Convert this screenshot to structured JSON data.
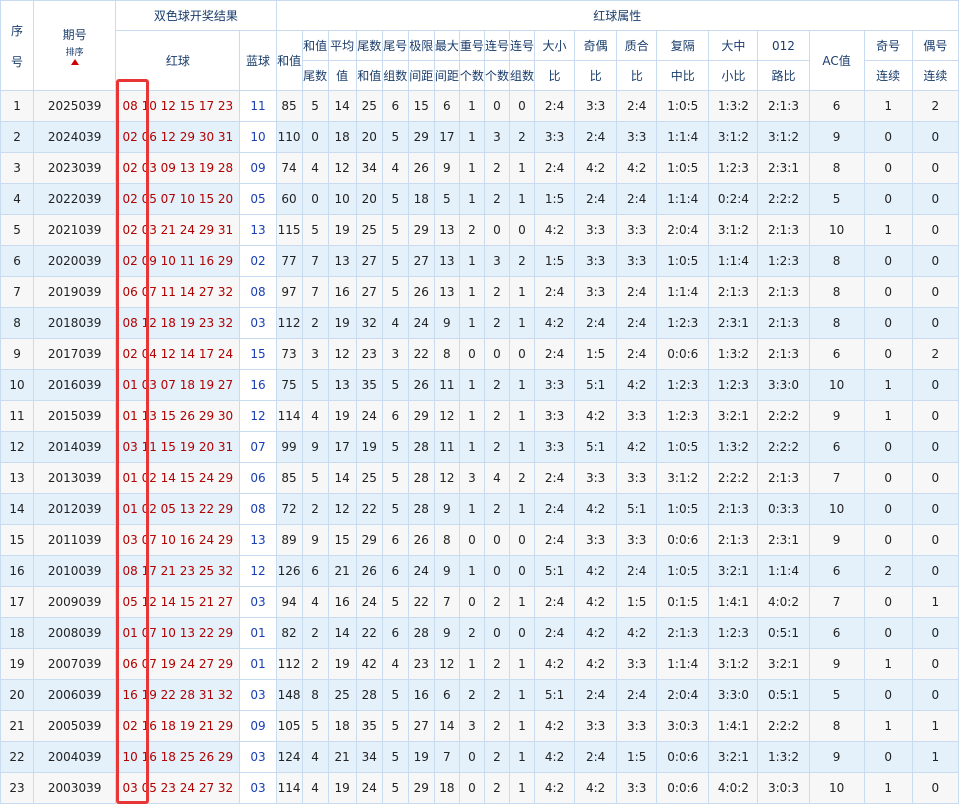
{
  "headers": {
    "seq": [
      "序",
      "号"
    ],
    "issue": "期号",
    "sort_label": "排序",
    "draw_result": "双色球开奖结果",
    "red_ball": "红球",
    "blue_ball": "蓝球",
    "red_attr": "红球属性",
    "sum": "和值",
    "sum_tail": [
      "和值",
      "尾数"
    ],
    "avg": [
      "平均",
      "值"
    ],
    "tail_sum": [
      "尾数",
      "和值"
    ],
    "tail_group": [
      "尾号",
      "组数"
    ],
    "range": [
      "极限",
      "间距"
    ],
    "max_gap": [
      "最大",
      "间距"
    ],
    "repeat": [
      "重号",
      "个数"
    ],
    "consec_count": [
      "连号",
      "个数"
    ],
    "consec_group": [
      "连号",
      "组数"
    ],
    "big_small": [
      "大小",
      "比"
    ],
    "odd_even": [
      "奇偶",
      "比"
    ],
    "prime_comp": [
      "质合",
      "比"
    ],
    "skip": [
      "复隔",
      "中比"
    ],
    "bms": [
      "大中",
      "小比"
    ],
    "route": [
      "012",
      "路比"
    ],
    "ac": "AC值",
    "odd_consec": [
      "奇号",
      "连续"
    ],
    "even_consec": [
      "偶号",
      "连续"
    ]
  },
  "rows": [
    {
      "seq": "1",
      "issue": "2025039",
      "red": "08 10 12 15 17 23",
      "blue": "11",
      "sum": "85",
      "sum_tail": "5",
      "avg": "14",
      "tail_sum": "25",
      "tail_group": "6",
      "range": "15",
      "max_gap": "6",
      "repeat": "1",
      "consec_count": "0",
      "consec_group": "0",
      "big_small": "2:4",
      "odd_even": "3:3",
      "prime_comp": "2:4",
      "skip": "1:0:5",
      "bms": "1:3:2",
      "route": "2:1:3",
      "ac": "6",
      "odd_consec": "1",
      "even_consec": "2"
    },
    {
      "seq": "2",
      "issue": "2024039",
      "red": "02 06 12 29 30 31",
      "blue": "10",
      "sum": "110",
      "sum_tail": "0",
      "avg": "18",
      "tail_sum": "20",
      "tail_group": "5",
      "range": "29",
      "max_gap": "17",
      "repeat": "1",
      "consec_count": "3",
      "consec_group": "2",
      "big_small": "3:3",
      "odd_even": "2:4",
      "prime_comp": "3:3",
      "skip": "1:1:4",
      "bms": "3:1:2",
      "route": "3:1:2",
      "ac": "9",
      "odd_consec": "0",
      "even_consec": "0"
    },
    {
      "seq": "3",
      "issue": "2023039",
      "red": "02 03 09 13 19 28",
      "blue": "09",
      "sum": "74",
      "sum_tail": "4",
      "avg": "12",
      "tail_sum": "34",
      "tail_group": "4",
      "range": "26",
      "max_gap": "9",
      "repeat": "1",
      "consec_count": "2",
      "consec_group": "1",
      "big_small": "2:4",
      "odd_even": "4:2",
      "prime_comp": "4:2",
      "skip": "1:0:5",
      "bms": "1:2:3",
      "route": "2:3:1",
      "ac": "8",
      "odd_consec": "0",
      "even_consec": "0"
    },
    {
      "seq": "4",
      "issue": "2022039",
      "red": "02 05 07 10 15 20",
      "blue": "05",
      "sum": "60",
      "sum_tail": "0",
      "avg": "10",
      "tail_sum": "20",
      "tail_group": "5",
      "range": "18",
      "max_gap": "5",
      "repeat": "1",
      "consec_count": "2",
      "consec_group": "1",
      "big_small": "1:5",
      "odd_even": "2:4",
      "prime_comp": "2:4",
      "skip": "1:1:4",
      "bms": "0:2:4",
      "route": "2:2:2",
      "ac": "5",
      "odd_consec": "0",
      "even_consec": "0"
    },
    {
      "seq": "5",
      "issue": "2021039",
      "red": "02 03 21 24 29 31",
      "blue": "13",
      "sum": "115",
      "sum_tail": "5",
      "avg": "19",
      "tail_sum": "25",
      "tail_group": "5",
      "range": "29",
      "max_gap": "13",
      "repeat": "2",
      "consec_count": "0",
      "consec_group": "0",
      "big_small": "4:2",
      "odd_even": "3:3",
      "prime_comp": "3:3",
      "skip": "2:0:4",
      "bms": "3:1:2",
      "route": "2:1:3",
      "ac": "10",
      "odd_consec": "1",
      "even_consec": "0"
    },
    {
      "seq": "6",
      "issue": "2020039",
      "red": "02 09 10 11 16 29",
      "blue": "02",
      "sum": "77",
      "sum_tail": "7",
      "avg": "13",
      "tail_sum": "27",
      "tail_group": "5",
      "range": "27",
      "max_gap": "13",
      "repeat": "1",
      "consec_count": "3",
      "consec_group": "2",
      "big_small": "1:5",
      "odd_even": "3:3",
      "prime_comp": "3:3",
      "skip": "1:0:5",
      "bms": "1:1:4",
      "route": "1:2:3",
      "ac": "8",
      "odd_consec": "0",
      "even_consec": "0"
    },
    {
      "seq": "7",
      "issue": "2019039",
      "red": "06 07 11 14 27 32",
      "blue": "08",
      "sum": "97",
      "sum_tail": "7",
      "avg": "16",
      "tail_sum": "27",
      "tail_group": "5",
      "range": "26",
      "max_gap": "13",
      "repeat": "1",
      "consec_count": "2",
      "consec_group": "1",
      "big_small": "2:4",
      "odd_even": "3:3",
      "prime_comp": "2:4",
      "skip": "1:1:4",
      "bms": "2:1:3",
      "route": "2:1:3",
      "ac": "8",
      "odd_consec": "0",
      "even_consec": "0"
    },
    {
      "seq": "8",
      "issue": "2018039",
      "red": "08 12 18 19 23 32",
      "blue": "03",
      "sum": "112",
      "sum_tail": "2",
      "avg": "19",
      "tail_sum": "32",
      "tail_group": "4",
      "range": "24",
      "max_gap": "9",
      "repeat": "1",
      "consec_count": "2",
      "consec_group": "1",
      "big_small": "4:2",
      "odd_even": "2:4",
      "prime_comp": "2:4",
      "skip": "1:2:3",
      "bms": "2:3:1",
      "route": "2:1:3",
      "ac": "8",
      "odd_consec": "0",
      "even_consec": "0"
    },
    {
      "seq": "9",
      "issue": "2017039",
      "red": "02 04 12 14 17 24",
      "blue": "15",
      "sum": "73",
      "sum_tail": "3",
      "avg": "12",
      "tail_sum": "23",
      "tail_group": "3",
      "range": "22",
      "max_gap": "8",
      "repeat": "0",
      "consec_count": "0",
      "consec_group": "0",
      "big_small": "2:4",
      "odd_even": "1:5",
      "prime_comp": "2:4",
      "skip": "0:0:6",
      "bms": "1:3:2",
      "route": "2:1:3",
      "ac": "6",
      "odd_consec": "0",
      "even_consec": "2"
    },
    {
      "seq": "10",
      "issue": "2016039",
      "red": "01 03 07 18 19 27",
      "blue": "16",
      "sum": "75",
      "sum_tail": "5",
      "avg": "13",
      "tail_sum": "35",
      "tail_group": "5",
      "range": "26",
      "max_gap": "11",
      "repeat": "1",
      "consec_count": "2",
      "consec_group": "1",
      "big_small": "3:3",
      "odd_even": "5:1",
      "prime_comp": "4:2",
      "skip": "1:2:3",
      "bms": "1:2:3",
      "route": "3:3:0",
      "ac": "10",
      "odd_consec": "1",
      "even_consec": "0"
    },
    {
      "seq": "11",
      "issue": "2015039",
      "red": "01 13 15 26 29 30",
      "blue": "12",
      "sum": "114",
      "sum_tail": "4",
      "avg": "19",
      "tail_sum": "24",
      "tail_group": "6",
      "range": "29",
      "max_gap": "12",
      "repeat": "1",
      "consec_count": "2",
      "consec_group": "1",
      "big_small": "3:3",
      "odd_even": "4:2",
      "prime_comp": "3:3",
      "skip": "1:2:3",
      "bms": "3:2:1",
      "route": "2:2:2",
      "ac": "9",
      "odd_consec": "1",
      "even_consec": "0"
    },
    {
      "seq": "12",
      "issue": "2014039",
      "red": "03 11 15 19 20 31",
      "blue": "07",
      "sum": "99",
      "sum_tail": "9",
      "avg": "17",
      "tail_sum": "19",
      "tail_group": "5",
      "range": "28",
      "max_gap": "11",
      "repeat": "1",
      "consec_count": "2",
      "consec_group": "1",
      "big_small": "3:3",
      "odd_even": "5:1",
      "prime_comp": "4:2",
      "skip": "1:0:5",
      "bms": "1:3:2",
      "route": "2:2:2",
      "ac": "6",
      "odd_consec": "0",
      "even_consec": "0"
    },
    {
      "seq": "13",
      "issue": "2013039",
      "red": "01 02 14 15 24 29",
      "blue": "06",
      "sum": "85",
      "sum_tail": "5",
      "avg": "14",
      "tail_sum": "25",
      "tail_group": "5",
      "range": "28",
      "max_gap": "12",
      "repeat": "3",
      "consec_count": "4",
      "consec_group": "2",
      "big_small": "2:4",
      "odd_even": "3:3",
      "prime_comp": "3:3",
      "skip": "3:1:2",
      "bms": "2:2:2",
      "route": "2:1:3",
      "ac": "7",
      "odd_consec": "0",
      "even_consec": "0"
    },
    {
      "seq": "14",
      "issue": "2012039",
      "red": "01 02 05 13 22 29",
      "blue": "08",
      "sum": "72",
      "sum_tail": "2",
      "avg": "12",
      "tail_sum": "22",
      "tail_group": "5",
      "range": "28",
      "max_gap": "9",
      "repeat": "1",
      "consec_count": "2",
      "consec_group": "1",
      "big_small": "2:4",
      "odd_even": "4:2",
      "prime_comp": "5:1",
      "skip": "1:0:5",
      "bms": "2:1:3",
      "route": "0:3:3",
      "ac": "10",
      "odd_consec": "0",
      "even_consec": "0"
    },
    {
      "seq": "15",
      "issue": "2011039",
      "red": "03 07 10 16 24 29",
      "blue": "13",
      "sum": "89",
      "sum_tail": "9",
      "avg": "15",
      "tail_sum": "29",
      "tail_group": "6",
      "range": "26",
      "max_gap": "8",
      "repeat": "0",
      "consec_count": "0",
      "consec_group": "0",
      "big_small": "2:4",
      "odd_even": "3:3",
      "prime_comp": "3:3",
      "skip": "0:0:6",
      "bms": "2:1:3",
      "route": "2:3:1",
      "ac": "9",
      "odd_consec": "0",
      "even_consec": "0"
    },
    {
      "seq": "16",
      "issue": "2010039",
      "red": "08 17 21 23 25 32",
      "blue": "12",
      "sum": "126",
      "sum_tail": "6",
      "avg": "21",
      "tail_sum": "26",
      "tail_group": "6",
      "range": "24",
      "max_gap": "9",
      "repeat": "1",
      "consec_count": "0",
      "consec_group": "0",
      "big_small": "5:1",
      "odd_even": "4:2",
      "prime_comp": "2:4",
      "skip": "1:0:5",
      "bms": "3:2:1",
      "route": "1:1:4",
      "ac": "6",
      "odd_consec": "2",
      "even_consec": "0"
    },
    {
      "seq": "17",
      "issue": "2009039",
      "red": "05 12 14 15 21 27",
      "blue": "03",
      "sum": "94",
      "sum_tail": "4",
      "avg": "16",
      "tail_sum": "24",
      "tail_group": "5",
      "range": "22",
      "max_gap": "7",
      "repeat": "0",
      "consec_count": "2",
      "consec_group": "1",
      "big_small": "2:4",
      "odd_even": "4:2",
      "prime_comp": "1:5",
      "skip": "0:1:5",
      "bms": "1:4:1",
      "route": "4:0:2",
      "ac": "7",
      "odd_consec": "0",
      "even_consec": "1"
    },
    {
      "seq": "18",
      "issue": "2008039",
      "red": "01 07 10 13 22 29",
      "blue": "01",
      "sum": "82",
      "sum_tail": "2",
      "avg": "14",
      "tail_sum": "22",
      "tail_group": "6",
      "range": "28",
      "max_gap": "9",
      "repeat": "2",
      "consec_count": "0",
      "consec_group": "0",
      "big_small": "2:4",
      "odd_even": "4:2",
      "prime_comp": "4:2",
      "skip": "2:1:3",
      "bms": "1:2:3",
      "route": "0:5:1",
      "ac": "6",
      "odd_consec": "0",
      "even_consec": "0"
    },
    {
      "seq": "19",
      "issue": "2007039",
      "red": "06 07 19 24 27 29",
      "blue": "01",
      "sum": "112",
      "sum_tail": "2",
      "avg": "19",
      "tail_sum": "42",
      "tail_group": "4",
      "range": "23",
      "max_gap": "12",
      "repeat": "1",
      "consec_count": "2",
      "consec_group": "1",
      "big_small": "4:2",
      "odd_even": "4:2",
      "prime_comp": "3:3",
      "skip": "1:1:4",
      "bms": "3:1:2",
      "route": "3:2:1",
      "ac": "9",
      "odd_consec": "1",
      "even_consec": "0"
    },
    {
      "seq": "20",
      "issue": "2006039",
      "red": "16 19 22 28 31 32",
      "blue": "03",
      "sum": "148",
      "sum_tail": "8",
      "avg": "25",
      "tail_sum": "28",
      "tail_group": "5",
      "range": "16",
      "max_gap": "6",
      "repeat": "2",
      "consec_count": "2",
      "consec_group": "1",
      "big_small": "5:1",
      "odd_even": "2:4",
      "prime_comp": "2:4",
      "skip": "2:0:4",
      "bms": "3:3:0",
      "route": "0:5:1",
      "ac": "5",
      "odd_consec": "0",
      "even_consec": "0"
    },
    {
      "seq": "21",
      "issue": "2005039",
      "red": "02 16 18 19 21 29",
      "blue": "09",
      "sum": "105",
      "sum_tail": "5",
      "avg": "18",
      "tail_sum": "35",
      "tail_group": "5",
      "range": "27",
      "max_gap": "14",
      "repeat": "3",
      "consec_count": "2",
      "consec_group": "1",
      "big_small": "4:2",
      "odd_even": "3:3",
      "prime_comp": "3:3",
      "skip": "3:0:3",
      "bms": "1:4:1",
      "route": "2:2:2",
      "ac": "8",
      "odd_consec": "1",
      "even_consec": "1"
    },
    {
      "seq": "22",
      "issue": "2004039",
      "red": "10 16 18 25 26 29",
      "blue": "03",
      "sum": "124",
      "sum_tail": "4",
      "avg": "21",
      "tail_sum": "34",
      "tail_group": "5",
      "range": "19",
      "max_gap": "7",
      "repeat": "0",
      "consec_count": "2",
      "consec_group": "1",
      "big_small": "4:2",
      "odd_even": "2:4",
      "prime_comp": "1:5",
      "skip": "0:0:6",
      "bms": "3:2:1",
      "route": "1:3:2",
      "ac": "9",
      "odd_consec": "0",
      "even_consec": "1"
    },
    {
      "seq": "23",
      "issue": "2003039",
      "red": "03 05 23 24 27 32",
      "blue": "03",
      "sum": "114",
      "sum_tail": "4",
      "avg": "19",
      "tail_sum": "24",
      "tail_group": "5",
      "range": "29",
      "max_gap": "18",
      "repeat": "0",
      "consec_count": "2",
      "consec_group": "1",
      "big_small": "4:2",
      "odd_even": "4:2",
      "prime_comp": "3:3",
      "skip": "0:0:6",
      "bms": "4:0:2",
      "route": "3:0:3",
      "ac": "10",
      "odd_consec": "1",
      "even_consec": "0"
    }
  ],
  "colors": {
    "header_text": "#1a3d6b",
    "border": "#c9dcef",
    "row_even": "#e4f1fb",
    "row_odd": "#f7f7f7",
    "red_ball": "#b00000",
    "blue_ball": "#1a3fb5",
    "highlight": "#e83535",
    "sort_arrow": "#d00000"
  }
}
